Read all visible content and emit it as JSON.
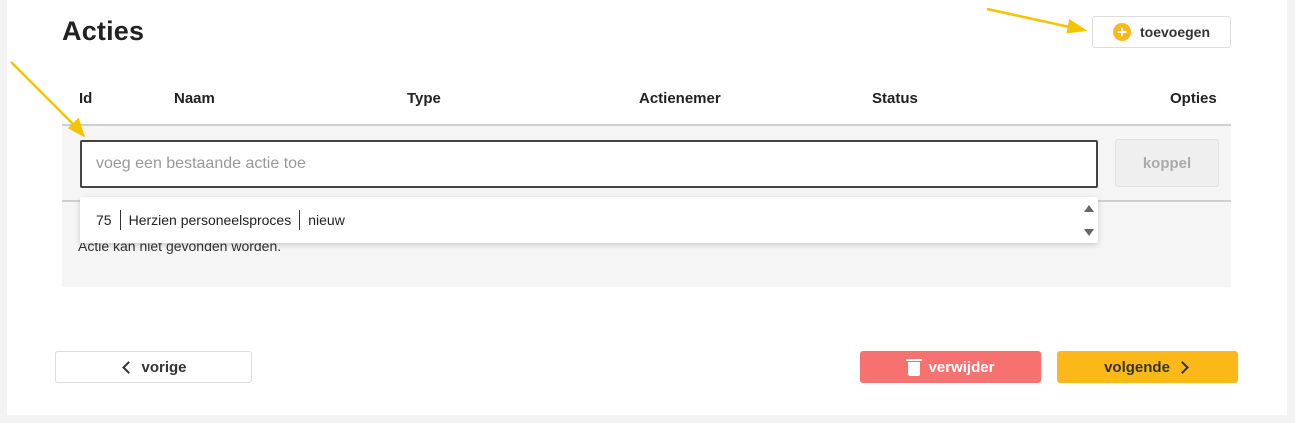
{
  "page": {
    "title": "Acties",
    "add_button_label": "toevoegen"
  },
  "table": {
    "columns": [
      "Id",
      "Naam",
      "Type",
      "Actienemer",
      "Status",
      "Opties"
    ]
  },
  "search": {
    "placeholder": "voeg een bestaande actie toe",
    "link_button_label": "koppel",
    "not_found_text": "Actie kan niet gevonden worden."
  },
  "dropdown": {
    "items": [
      {
        "id": "75",
        "name": "Herzien personeelsproces",
        "status": "nieuw"
      }
    ]
  },
  "footer": {
    "prev_label": "vorige",
    "delete_label": "verwijder",
    "next_label": "volgende"
  },
  "colors": {
    "accent": "#fbb818",
    "danger": "#f87171",
    "annotation_arrow": "#f5c400"
  },
  "icons": [
    "plus-circle-icon",
    "trash-icon",
    "chevron-left-icon",
    "chevron-right-icon",
    "scroll-up-icon",
    "scroll-down-icon"
  ]
}
